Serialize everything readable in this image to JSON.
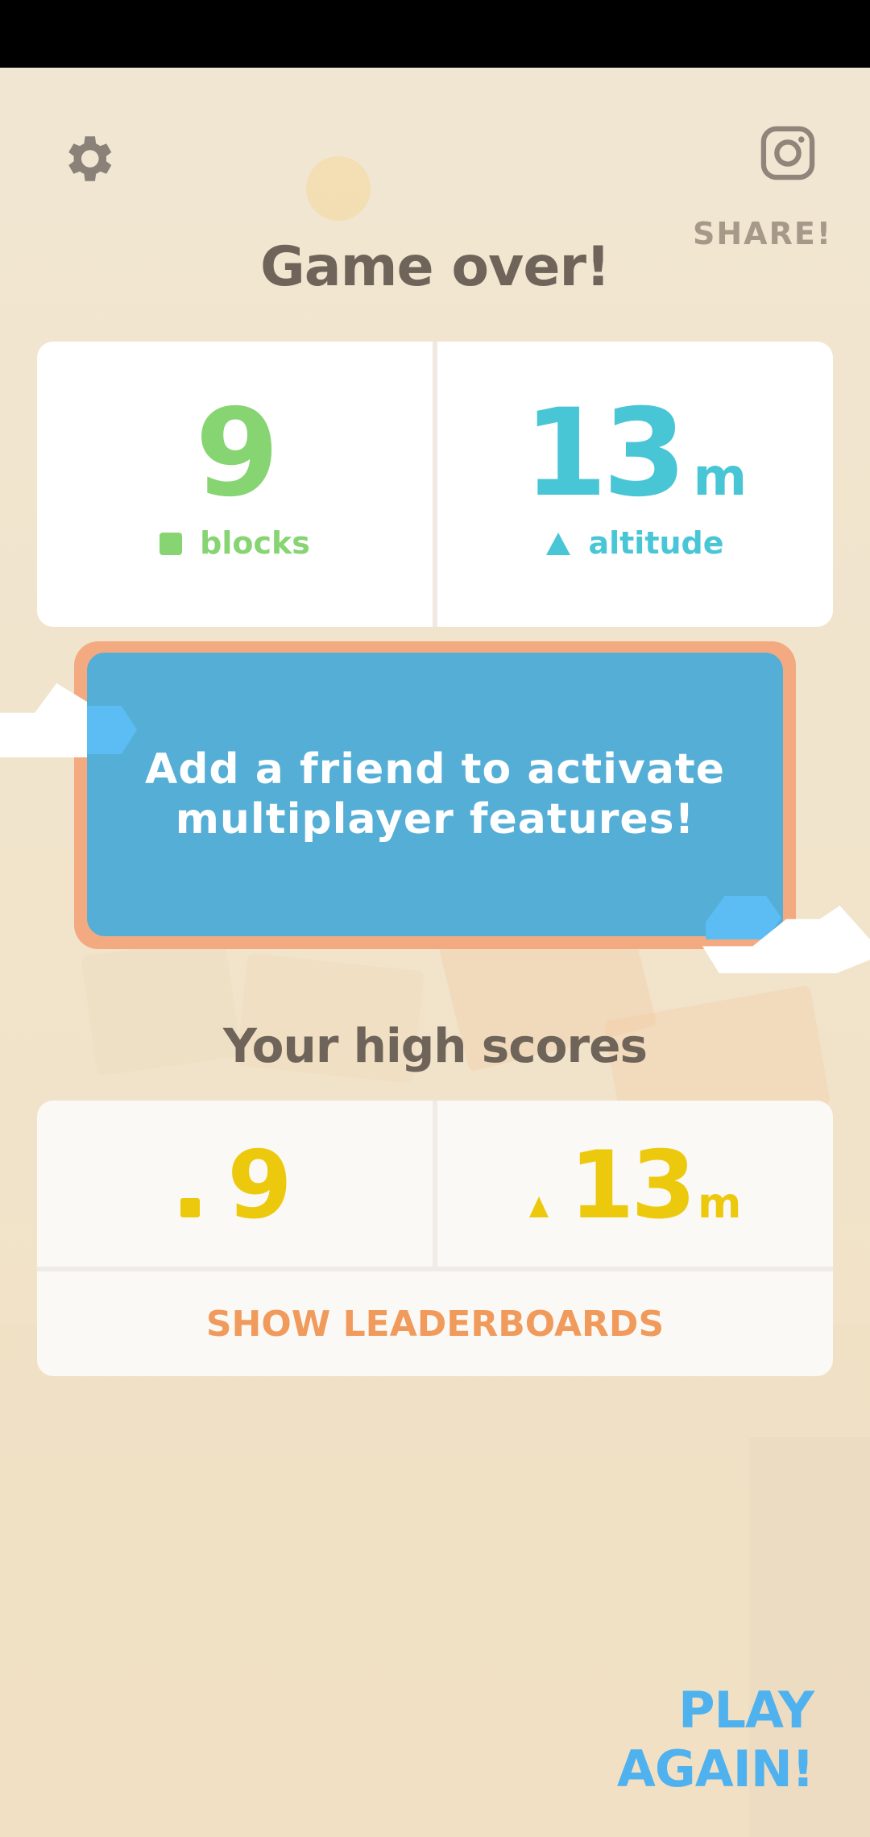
{
  "header": {
    "settings_icon": "gear-icon",
    "share_icon": "camera-icon",
    "share_label": "SHARE!"
  },
  "title": "Game over!",
  "score": {
    "blocks_value": "9",
    "blocks_label": "blocks",
    "altitude_value": "13",
    "altitude_unit": "m",
    "altitude_label": "altitude"
  },
  "friend_banner": {
    "line1": "Add a friend to activate",
    "line2": "multiplayer features!"
  },
  "high_scores": {
    "title": "Your high scores",
    "blocks_value": "9",
    "altitude_value": "13",
    "altitude_unit": "m",
    "leaderboards_label": "SHOW LEADERBOARDS"
  },
  "play_again_label": "PLAY AGAIN!",
  "colors": {
    "background": "#f1e6d2",
    "blocks_green": "#87d472",
    "altitude_teal": "#48c6d6",
    "banner_blue": "#55aed6",
    "banner_border": "#f4aa80",
    "highscore_yellow": "#edc90e",
    "leaderboard_orange": "#f09a5c",
    "play_blue": "#4fb2ee"
  }
}
